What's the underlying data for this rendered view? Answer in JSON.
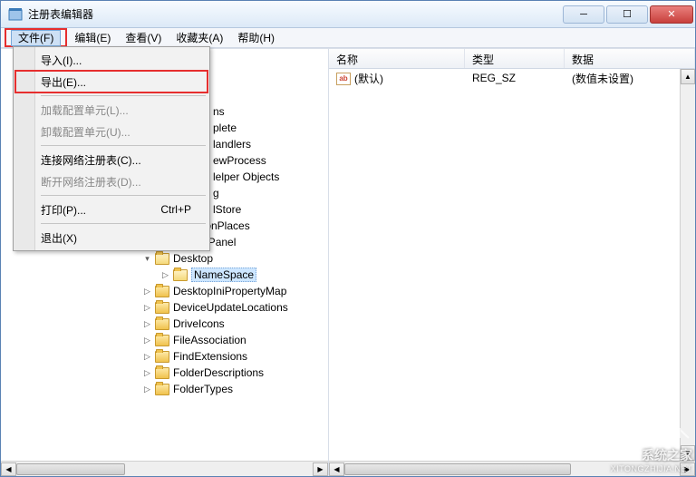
{
  "window": {
    "title": "注册表编辑器"
  },
  "menubar": {
    "items": [
      {
        "label": "文件(F)"
      },
      {
        "label": "编辑(E)"
      },
      {
        "label": "查看(V)"
      },
      {
        "label": "收藏夹(A)"
      },
      {
        "label": "帮助(H)"
      }
    ]
  },
  "dropdown": {
    "import": "导入(I)...",
    "export": "导出(E)...",
    "load_hive": "加载配置单元(L)...",
    "unload_hive": "卸载配置单元(U)...",
    "connect": "连接网络注册表(C)...",
    "disconnect": "断开网络注册表(D)...",
    "print": "打印(P)...",
    "print_shortcut": "Ctrl+P",
    "exit": "退出(X)"
  },
  "tree": {
    "partial": [
      {
        "label": "ns",
        "indent": 234
      },
      {
        "label": "plete",
        "indent": 234
      },
      {
        "label": "landlers",
        "indent": 234
      },
      {
        "label": "ewProcess",
        "indent": 234
      },
      {
        "label": "lelper Objects",
        "indent": 234
      },
      {
        "label": "g",
        "indent": 234
      },
      {
        "label": "lStore",
        "indent": 234
      }
    ],
    "visible": [
      {
        "label": "CommonPlaces",
        "indent": 156,
        "toggle": "▷"
      },
      {
        "label": "ControlPanel",
        "indent": 156,
        "toggle": "▷"
      },
      {
        "label": "Desktop",
        "indent": 156,
        "toggle": "▾",
        "open": true
      },
      {
        "label": "NameSpace",
        "indent": 176,
        "toggle": "▷",
        "open": true,
        "selected": true
      },
      {
        "label": "DesktopIniPropertyMap",
        "indent": 156,
        "toggle": "▷"
      },
      {
        "label": "DeviceUpdateLocations",
        "indent": 156,
        "toggle": "▷"
      },
      {
        "label": "DriveIcons",
        "indent": 156,
        "toggle": "▷"
      },
      {
        "label": "FileAssociation",
        "indent": 156,
        "toggle": "▷"
      },
      {
        "label": "FindExtensions",
        "indent": 156,
        "toggle": "▷"
      },
      {
        "label": "FolderDescriptions",
        "indent": 156,
        "toggle": "▷"
      },
      {
        "label": "FolderTypes",
        "indent": 156,
        "toggle": "▷"
      }
    ]
  },
  "list": {
    "columns": {
      "name": "名称",
      "type": "类型",
      "data": "数据"
    },
    "rows": [
      {
        "name": "(默认)",
        "type": "REG_SZ",
        "data": "(数值未设置)"
      }
    ]
  },
  "watermark": {
    "site": "系统之家",
    "url": "XITONGZHIJIA.NET"
  }
}
